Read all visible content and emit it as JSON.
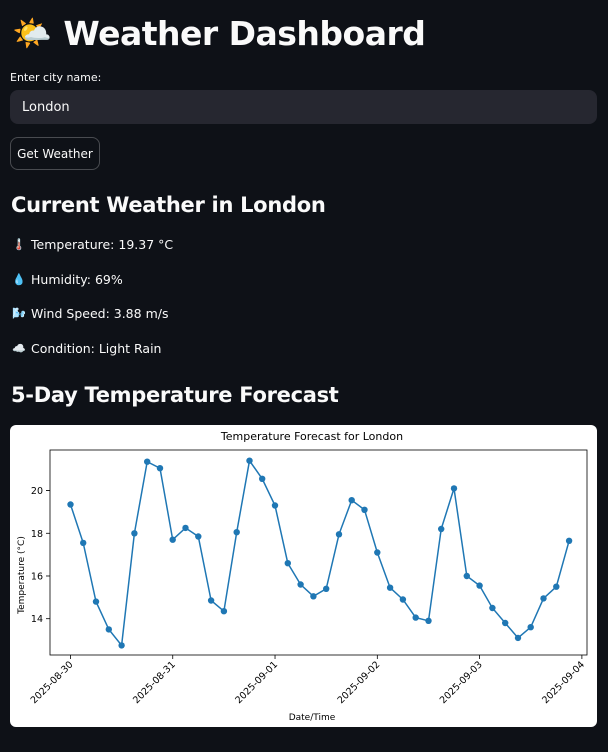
{
  "app": {
    "title": "Weather Dashboard",
    "title_emoji": "🌤️"
  },
  "form": {
    "city_label": "Enter city name:",
    "city_value": "London",
    "button_label": "Get Weather"
  },
  "current": {
    "heading": "Current Weather in London",
    "temperature": {
      "icon": "🌡️",
      "icon_name": "thermometer-icon",
      "text": "Temperature: 19.37 °C"
    },
    "humidity": {
      "icon": "💧",
      "icon_name": "droplet-icon",
      "text": "Humidity: 69%"
    },
    "wind": {
      "icon": "🌬️",
      "icon_name": "wind-icon",
      "text": "Wind Speed: 3.88 m/s"
    },
    "condition": {
      "icon": "☁️",
      "icon_name": "cloud-icon",
      "text": "Condition: Light Rain"
    }
  },
  "forecast": {
    "heading": "5-Day Temperature Forecast"
  },
  "colors": {
    "background": "#0e1117",
    "input_bg": "#262730",
    "text": "#fafafa",
    "series": "#1f77b4"
  },
  "chart_data": {
    "type": "line",
    "title": "Temperature Forecast for London",
    "xlabel": "Date/Time",
    "ylabel": "Temperature (°C)",
    "x_start": "2025-08-30",
    "x_step_hours": 3,
    "xticks": [
      "2025-08-30",
      "2025-08-31",
      "2025-09-01",
      "2025-09-02",
      "2025-09-03",
      "2025-09-04"
    ],
    "yticks": [
      14,
      16,
      18,
      20
    ],
    "ylim": [
      12.3,
      21.9
    ],
    "xlim_days": [
      -0.2,
      5.05
    ],
    "grid": false,
    "series": [
      {
        "values": [
          19.35,
          17.55,
          14.8,
          13.5,
          12.75,
          18.0,
          21.35,
          21.05,
          17.7,
          18.25,
          17.85,
          14.85,
          14.35,
          18.05,
          21.4,
          20.55,
          19.3,
          16.6,
          15.6,
          15.05,
          15.4,
          17.95,
          19.55,
          19.1,
          17.1,
          15.45,
          14.9,
          14.05,
          13.9,
          18.2,
          20.1,
          16.0,
          15.55,
          14.5,
          13.8,
          13.1,
          13.6,
          14.95,
          15.5,
          17.65
        ]
      }
    ]
  }
}
